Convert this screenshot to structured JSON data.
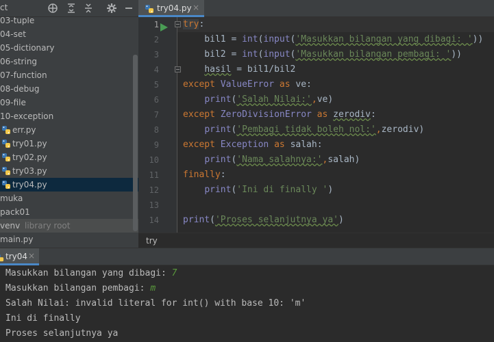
{
  "project_panel": {
    "title": "ct",
    "toolbar_icons": [
      "crosshair-icon",
      "expand-all-icon",
      "collapse-all-icon",
      "gear-icon",
      "minimize-icon"
    ],
    "items": [
      {
        "label": "03-tuple",
        "icon": ""
      },
      {
        "label": "04-set",
        "icon": ""
      },
      {
        "label": "05-dictionary",
        "icon": ""
      },
      {
        "label": "06-string",
        "icon": ""
      },
      {
        "label": "07-function",
        "icon": ""
      },
      {
        "label": "08-debug",
        "icon": ""
      },
      {
        "label": "09-file",
        "icon": ""
      },
      {
        "label": "10-exception",
        "icon": ""
      },
      {
        "label": "err.py",
        "icon": "python-file-icon"
      },
      {
        "label": "try01.py",
        "icon": "python-file-icon"
      },
      {
        "label": "try02.py",
        "icon": "python-file-icon"
      },
      {
        "label": "try03.py",
        "icon": "python-file-icon"
      },
      {
        "label": "try04.py",
        "icon": "python-file-icon",
        "selected": true
      },
      {
        "label": "muka",
        "icon": ""
      },
      {
        "label": "pack01",
        "icon": ""
      },
      {
        "label": "venv",
        "extra": "library root",
        "icon": ""
      },
      {
        "label": "main.py",
        "icon": ""
      }
    ]
  },
  "editor": {
    "tab_label": "try04.py",
    "tab_close": "×",
    "breadcrumb": "try",
    "line_numbers": [
      "1",
      "2",
      "3",
      "4",
      "5",
      "6",
      "7",
      "8",
      "9",
      "10",
      "11",
      "12",
      "13",
      "14"
    ],
    "lines": [
      [
        {
          "t": "try",
          "c": "kw hl"
        },
        {
          "t": ":",
          "c": "plain"
        }
      ],
      [
        {
          "t": "    bil1 = ",
          "c": "plain"
        },
        {
          "t": "int",
          "c": "bi"
        },
        {
          "t": "(",
          "c": "plain"
        },
        {
          "t": "input",
          "c": "bi"
        },
        {
          "t": "(",
          "c": "plain"
        },
        {
          "t": "'Masukkan bilangan yang dibagi: '",
          "c": "str typo"
        },
        {
          "t": "))",
          "c": "plain"
        }
      ],
      [
        {
          "t": "    bil2 = ",
          "c": "plain"
        },
        {
          "t": "int",
          "c": "bi"
        },
        {
          "t": "(",
          "c": "plain"
        },
        {
          "t": "input",
          "c": "bi"
        },
        {
          "t": "(",
          "c": "plain"
        },
        {
          "t": "'Masukkan bilangan pembagi: '",
          "c": "str typo"
        },
        {
          "t": "))",
          "c": "plain"
        }
      ],
      [
        {
          "t": "    ",
          "c": "plain"
        },
        {
          "t": "hasil",
          "c": "plain typo"
        },
        {
          "t": " = bil1/bil2",
          "c": "plain"
        }
      ],
      [
        {
          "t": "except ",
          "c": "kw"
        },
        {
          "t": "ValueError",
          "c": "bi"
        },
        {
          "t": " as ",
          "c": "kw"
        },
        {
          "t": "ve:",
          "c": "plain"
        }
      ],
      [
        {
          "t": "    ",
          "c": "plain"
        },
        {
          "t": "print",
          "c": "bi"
        },
        {
          "t": "(",
          "c": "plain"
        },
        {
          "t": "'Salah Nilai:'",
          "c": "str typo"
        },
        {
          "t": ",",
          "c": "comma"
        },
        {
          "t": "ve)",
          "c": "plain"
        }
      ],
      [
        {
          "t": "except ",
          "c": "kw"
        },
        {
          "t": "ZeroDivisionError",
          "c": "bi"
        },
        {
          "t": " as ",
          "c": "kw"
        },
        {
          "t": "zerodiv",
          "c": "plain typo"
        },
        {
          "t": ":",
          "c": "plain"
        }
      ],
      [
        {
          "t": "    ",
          "c": "plain"
        },
        {
          "t": "print",
          "c": "bi"
        },
        {
          "t": "(",
          "c": "plain"
        },
        {
          "t": "'Pembagi tidak boleh nol:'",
          "c": "str typo"
        },
        {
          "t": ",",
          "c": "comma"
        },
        {
          "t": "zerodiv)",
          "c": "plain"
        }
      ],
      [
        {
          "t": "except ",
          "c": "kw"
        },
        {
          "t": "Exception",
          "c": "bi"
        },
        {
          "t": " as ",
          "c": "kw"
        },
        {
          "t": "salah:",
          "c": "plain"
        }
      ],
      [
        {
          "t": "    ",
          "c": "plain"
        },
        {
          "t": "print",
          "c": "bi"
        },
        {
          "t": "(",
          "c": "plain"
        },
        {
          "t": "'Nama salahnya:'",
          "c": "str typo"
        },
        {
          "t": ",",
          "c": "comma"
        },
        {
          "t": "salah)",
          "c": "plain"
        }
      ],
      [
        {
          "t": "finally",
          "c": "kw"
        },
        {
          "t": ":",
          "c": "plain"
        }
      ],
      [
        {
          "t": "    ",
          "c": "plain"
        },
        {
          "t": "print",
          "c": "bi"
        },
        {
          "t": "(",
          "c": "plain"
        },
        {
          "t": "'Ini di finally '",
          "c": "str"
        },
        {
          "t": ")",
          "c": "plain"
        }
      ],
      [
        {
          "t": "",
          "c": "plain"
        }
      ],
      [
        {
          "t": "print",
          "c": "bi"
        },
        {
          "t": "(",
          "c": "plain"
        },
        {
          "t": "'Proses selanjutnya ya'",
          "c": "str typo"
        },
        {
          "t": ")",
          "c": "plain"
        }
      ]
    ]
  },
  "run_panel": {
    "tab_label": "try04",
    "tab_close": "×",
    "console": [
      [
        {
          "t": "Masukkan bilangan yang dibagi: ",
          "c": ""
        },
        {
          "t": "7",
          "c": "in"
        }
      ],
      [
        {
          "t": "Masukkan bilangan pembagi: ",
          "c": ""
        },
        {
          "t": "m",
          "c": "in"
        }
      ],
      [
        {
          "t": "Salah Nilai: invalid literal for int() with base 10: 'm'",
          "c": ""
        }
      ],
      [
        {
          "t": "Ini di finally",
          "c": ""
        }
      ],
      [
        {
          "t": "Proses selanjutnya ya",
          "c": ""
        }
      ]
    ]
  },
  "colors": {
    "keyword": "#cc7832",
    "builtin": "#8888c6",
    "string": "#6a8759",
    "user_input": "#5a9a3c",
    "selection": "#0d293e",
    "accent": "#4a88c7"
  }
}
